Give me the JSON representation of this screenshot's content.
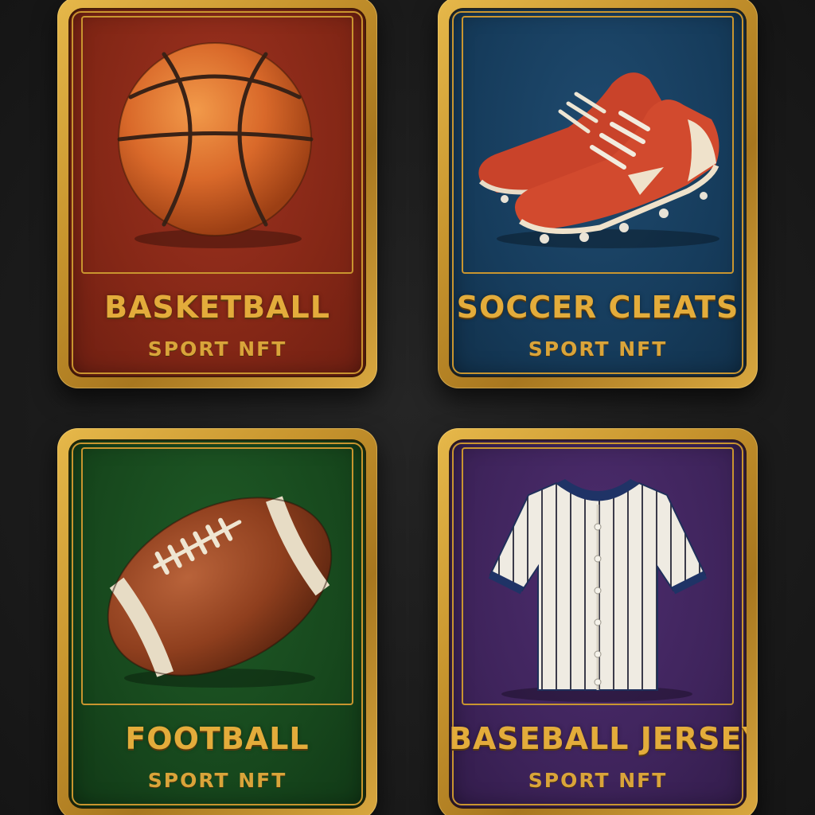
{
  "cards": [
    {
      "title": "BASKETBALL",
      "subtitle": "SPORT NFT",
      "background": "#842716",
      "art": "basketball-icon"
    },
    {
      "title": "SOCCER CLEATS",
      "subtitle": "SPORT NFT",
      "background": "#163c5c",
      "art": "soccer-cleats-icon"
    },
    {
      "title": "FOOTBALL",
      "subtitle": "SPORT NFT",
      "background": "#17481d",
      "art": "football-icon"
    },
    {
      "title": "BASEBALL JERSEY",
      "subtitle": "SPORT NFT",
      "background": "#3f245c",
      "art": "baseball-jersey-icon"
    }
  ],
  "colors": {
    "gold_border": "#c8952e",
    "gold_text": "#e3ac3b",
    "page_background": "#1b1b1b"
  }
}
